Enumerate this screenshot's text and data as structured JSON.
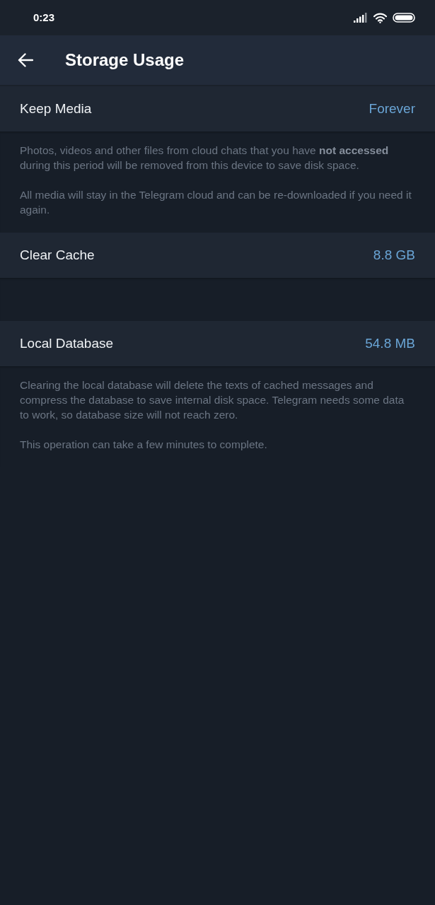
{
  "status_bar": {
    "time": "0:23"
  },
  "header": {
    "title": "Storage Usage"
  },
  "items": [
    {
      "kind": "setting",
      "label": "Keep Media",
      "value": "Forever"
    },
    {
      "kind": "info",
      "paragraphs": [
        "Photos, videos and other files from cloud chats that you have **not accessed** during this period will be removed from this device to save disk space.",
        "All media will stay in the Telegram cloud and can be re-downloaded if you need it again."
      ]
    },
    {
      "kind": "setting",
      "label": "Clear Cache",
      "value": "8.8 GB"
    },
    {
      "kind": "setting",
      "label": "Local Database",
      "value": "54.8 MB"
    },
    {
      "kind": "info",
      "paragraphs": [
        "Clearing the local database will delete the texts of cached messages and compress the database to save internal disk space. Telegram needs some data to work, so database size will not reach zero.",
        "This operation can take a few minutes to complete."
      ]
    }
  ]
}
